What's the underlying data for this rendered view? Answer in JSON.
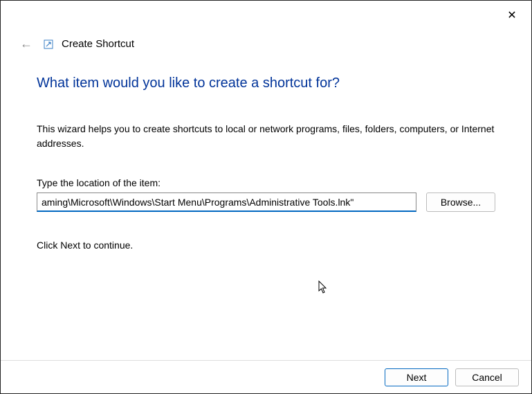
{
  "header": {
    "title": "Create Shortcut"
  },
  "main": {
    "heading": "What item would you like to create a shortcut for?",
    "description": "This wizard helps you to create shortcuts to local or network programs, files, folders, computers, or Internet addresses.",
    "field_label": "Type the location of the item:",
    "location_value": "aming\\Microsoft\\Windows\\Start Menu\\Programs\\Administrative Tools.lnk\"",
    "browse_label": "Browse...",
    "continue_text": "Click Next to continue."
  },
  "footer": {
    "next_label": "Next",
    "cancel_label": "Cancel"
  }
}
